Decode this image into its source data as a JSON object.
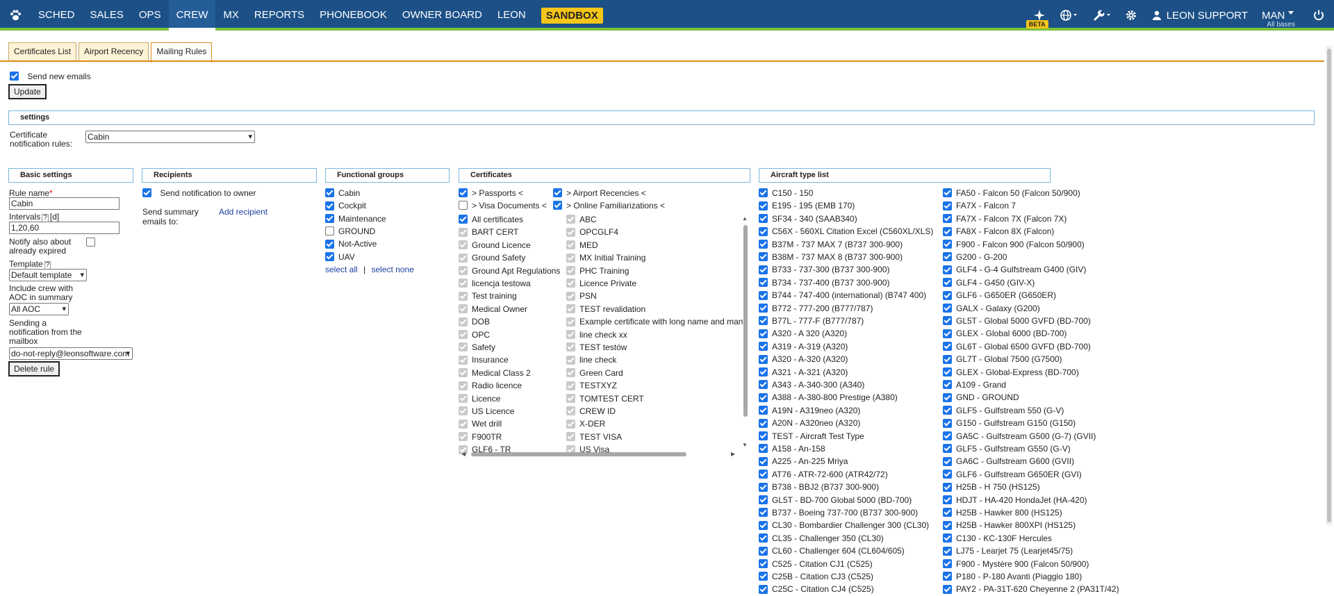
{
  "nav": {
    "items": [
      "SCHED",
      "SALES",
      "OPS",
      "CREW",
      "MX",
      "REPORTS",
      "PHONEBOOK",
      "OWNER BOARD",
      "LEON"
    ],
    "sandbox": "SANDBOX",
    "active": "CREW",
    "beta": "BETA",
    "user": "LEON SUPPORT",
    "man": "MAN",
    "all_bases": "All bases",
    "colors": {
      "bar": "#1c5087",
      "accent_line": "#7cc13c",
      "sandbox": "#f5c518"
    }
  },
  "tabs": [
    "Certificates List",
    "Airport Recency",
    "Mailing Rules"
  ],
  "send_new_emails": "Send new emails",
  "update": "Update",
  "settings": {
    "title": "settings",
    "cert_rules_label_1": "Certificate",
    "cert_rules_label_2": "notification rules:",
    "cert_rules_value": "Cabin"
  },
  "basic": {
    "title": "Basic settings",
    "rule_name_label": "Rule name",
    "required_mark": "*",
    "rule_name_value": "Cabin",
    "intervals_label": "Intervals",
    "q": "?",
    "intervals_unit": "[d]",
    "intervals_value": "1,20,60",
    "notify_label_1": "Notify also about",
    "notify_label_2": "already expired",
    "template_label": "Template",
    "template_value": "Default template",
    "include_label_1": "Include crew with",
    "include_label_2": "AOC in summary",
    "aoc_value": "All AOC",
    "sending_1": "Sending a",
    "sending_2": "notification from the",
    "sending_3": "mailbox",
    "mailbox_value": "do-not-reply@leonsoftware.com",
    "delete": "Delete rule"
  },
  "recipients": {
    "title": "Recipients",
    "send_owner": "Send notification to owner",
    "summary_1": "Send summary",
    "summary_2": "emails to:",
    "add_recipient": "Add recipient"
  },
  "functional": {
    "title": "Functional groups",
    "items": [
      {
        "label": "Cabin",
        "checked": true
      },
      {
        "label": "Cockpit",
        "checked": true
      },
      {
        "label": "Maintenance",
        "checked": true
      },
      {
        "label": "GROUND",
        "checked": false
      },
      {
        "label": "Not-Active",
        "checked": true
      },
      {
        "label": "UAV",
        "checked": true
      }
    ],
    "select_all": "select all",
    "sep": "|",
    "select_none": "select none"
  },
  "certificates": {
    "title": "Certificates",
    "groups": [
      {
        "label": "> Passports <",
        "checked": true
      },
      {
        "label": "> Airport Recencies <",
        "checked": true
      },
      {
        "label": "> Visa Documents <",
        "checked": false
      },
      {
        "label": "> Online Familiarizations <",
        "checked": true
      }
    ],
    "all_certificates": "All certificates",
    "col1": [
      "BART CERT",
      "Ground Licence",
      "Ground Safety",
      "Ground Apt Regulations",
      "licencja testowa",
      "Test training",
      "Medical Owner",
      "DOB",
      "OPC",
      "Safety",
      "Insurance",
      "Medical Class 2",
      "Radio licence",
      "Licence",
      "US Licence",
      "Wet drill",
      "F900TR",
      "GLF6 - TR"
    ],
    "col2": [
      "ABC",
      "OPCGLF4",
      "MED",
      "MX Initial Training",
      "PHC Training",
      "Licence Private",
      "PSN",
      "TEST revalidation",
      "Example certificate with long name and many",
      "line check xx",
      "TEST testów",
      "line check",
      "Green Card",
      "TESTXYZ",
      "TOMTEST CERT",
      "CREW ID",
      "X-DER",
      "TEST VISA",
      "US Visa"
    ]
  },
  "aircraft": {
    "title": "Aircraft type list",
    "col1": [
      "C150 - 150",
      "E195 - 195 (EMB 170)",
      "SF34 - 340 (SAAB340)",
      "C56X - 560XL Citation Excel (C560XL/XLS)",
      "B37M - 737 MAX 7 (B737 300-900)",
      "B38M - 737 MAX 8 (B737 300-900)",
      "B733 - 737-300 (B737 300-900)",
      "B734 - 737-400 (B737 300-900)",
      "B744 - 747-400 (international) (B747 400)",
      "B772 - 777-200 (B777/787)",
      "B77L - 777-F (B777/787)",
      "A320 - A 320 (A320)",
      "A319 - A-319 (A320)",
      "A320 - A-320 (A320)",
      "A321 - A-321 (A320)",
      "A343 - A-340-300 (A340)",
      "A388 - A-380-800 Prestige (A380)",
      "A19N - A319neo (A320)",
      "A20N - A320neo (A320)",
      "TEST - Aircraft Test Type",
      "A158 - An-158",
      "A225 - An-225 Mriya",
      "AT76 - ATR-72-600 (ATR42/72)",
      "B738 - BBJ2 (B737 300-900)",
      "GL5T - BD-700 Global 5000 (BD-700)",
      "B737 - Boeing 737-700 (B737 300-900)",
      "CL30 - Bombardier Challenger 300 (CL30)",
      "CL35 - Challenger 350 (CL30)",
      "CL60 - Challenger 604 (CL604/605)",
      "C525 - Citation CJ1 (C525)",
      "C25B - Citation CJ3 (C525)",
      "C25C - Citation CJ4 (C525)"
    ],
    "col2": [
      "FA50 - Falcon 50 (Falcon 50/900)",
      "FA7X - Falcon 7",
      "FA7X - Falcon 7X (Falcon 7X)",
      "FA8X - Falcon 8X (Falcon)",
      "F900 - Falcon 900 (Falcon 50/900)",
      "G200 - G-200",
      "GLF4 - G-4 Gulfstream G400 (GIV)",
      "GLF4 - G450 (GIV-X)",
      "GLF6 - G650ER (G650ER)",
      "GALX - Galaxy (G200)",
      "GL5T - Global 5000 GVFD (BD-700)",
      "GLEX - Global 6000 (BD-700)",
      "GL6T - Global 6500 GVFD (BD-700)",
      "GL7T - Global 7500 (G7500)",
      "GLEX - Global-Express (BD-700)",
      "A109 - Grand",
      "GND - GROUND",
      "GLF5 - Gulfstream 550 (G-V)",
      "G150 - Gulfstream G150 (G150)",
      "GA5C - Gulfstream G500 (G-7) (GVII)",
      "GLF5 - Gulfstream G550 (G-V)",
      "GA6C - Gulfstream G600 (GVII)",
      "GLF6 - Gulfstream G650ER (GVI)",
      "H25B - H 750 (HS125)",
      "HDJT - HA-420 HondaJet (HA-420)",
      "H25B - Hawker 800 (HS125)",
      "H25B - Hawker 800XPI (HS125)",
      "C130 - KC-130F Hercules",
      "LJ75 - Learjet 75 (Learjet45/75)",
      "F900 - Mystère 900 (Falcon 50/900)",
      "P180 - P-180 Avanti (Piaggio 180)",
      "PAY2 - PA-31T-620 Cheyenne 2 (PA31T/42)"
    ]
  }
}
